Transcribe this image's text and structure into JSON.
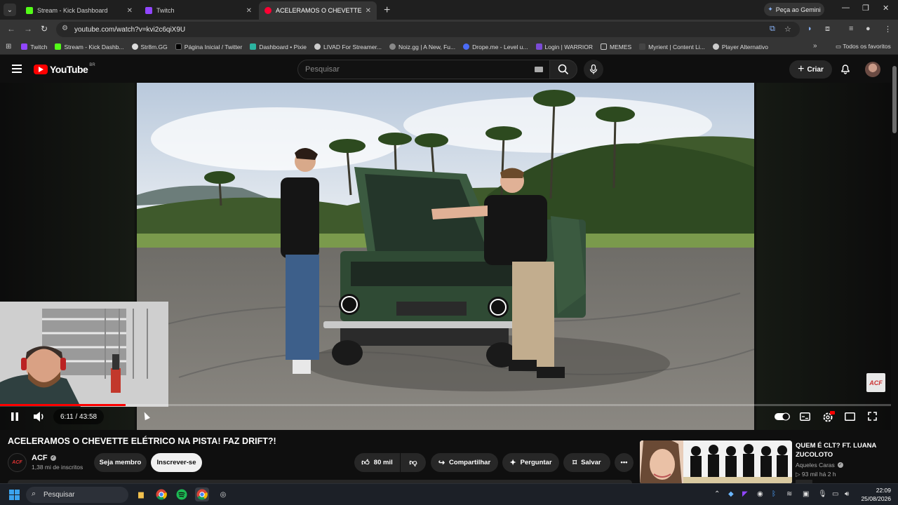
{
  "browser": {
    "tabs": [
      {
        "label": "Stream - Kick Dashboard",
        "color": "#53fc18"
      },
      {
        "label": "Twitch",
        "color": "#9146ff"
      },
      {
        "label": "ACELERAMOS O CHEVETTE",
        "color": "#ff0033"
      }
    ],
    "gemini_label": "Peça ao Gemini",
    "url": "youtube.com/watch?v=kvi2c6qiX9U",
    "bookmarks": [
      {
        "label": "Twitch",
        "color": "#9146ff"
      },
      {
        "label": "Stream - Kick Dashb...",
        "color": "#53fc18"
      },
      {
        "label": "Str8m.GG",
        "color": "#dddddd"
      },
      {
        "label": "Página Inicial / Twitter",
        "color": "#000000"
      },
      {
        "label": "Dashboard • Pixie",
        "color": "#2bb3a0"
      },
      {
        "label": "LIVAD For Streamer...",
        "color": "#cccccc"
      },
      {
        "label": "Noiz.gg | A New, Fu...",
        "color": "#888888"
      },
      {
        "label": "Drope.me - Level u...",
        "color": "#4b6cf7"
      },
      {
        "label": "Login | WARRIOR",
        "color": "#7b4bd6"
      },
      {
        "label": "MEMES",
        "color": "folder"
      },
      {
        "label": "Myrient | Content Li...",
        "color": "#444444"
      },
      {
        "label": "Player Alternativo",
        "color": "#cccccc"
      }
    ],
    "all_bookmarks": "Todos os favoritos"
  },
  "youtube": {
    "logo_text": "YouTube",
    "region": "BR",
    "search_placeholder": "Pesquisar",
    "create_label": "Criar"
  },
  "player": {
    "current_time": "6:11",
    "duration": "43:58",
    "time_display": "6:11 / 43:58",
    "progress_fraction": 0.1406,
    "channel_watermark": "ACF"
  },
  "video": {
    "title": "ACELERAMOS O CHEVETTE ELÉTRICO NA PISTA! FAZ DRIFT?!",
    "channel": "ACF",
    "subscribers": "1,38 mi de inscritos",
    "member_label": "Seja membro",
    "subscribe_label": "Inscrever-se",
    "likes": "80 mil",
    "share_label": "Compartilhar",
    "ask_label": "Perguntar",
    "save_label": "Salvar"
  },
  "recommendation": {
    "title": "QUEM É CLT? FT. LUANA ZUCOLOTO",
    "channel": "Aqueles Caras",
    "views": "93 mil",
    "age": "há 2 h",
    "meta": "▷ 93 mil  há 2 h"
  },
  "taskbar": {
    "search_label": "Pesquisar",
    "time": "22:09",
    "date": "25/08/2026"
  }
}
